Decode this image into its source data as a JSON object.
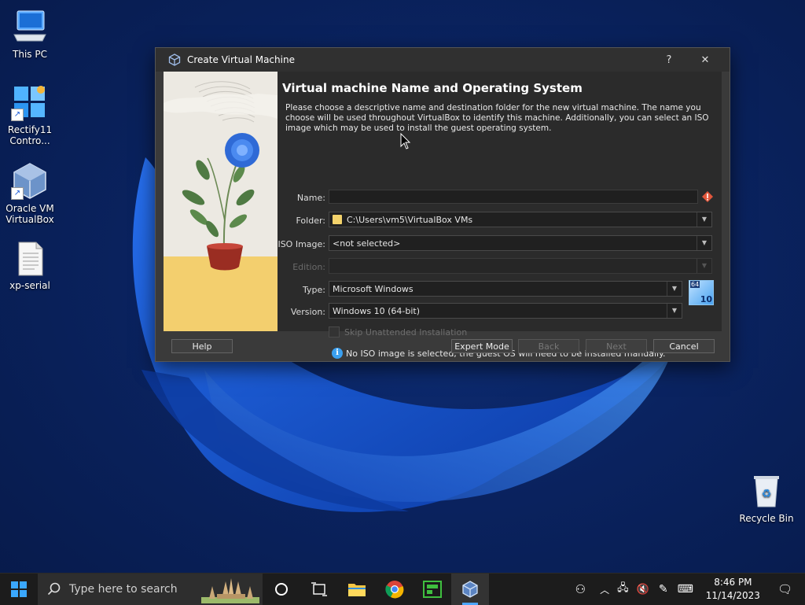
{
  "desktop": {
    "icons": [
      {
        "label": "This PC"
      },
      {
        "label": "Rectify11 Contro..."
      },
      {
        "label": "Oracle VM VirtualBox"
      },
      {
        "label": "xp-serial"
      },
      {
        "label": "Recycle Bin"
      }
    ]
  },
  "dialog": {
    "title": "Create Virtual Machine",
    "help_glyph": "?",
    "close_glyph": "✕",
    "heading": "Virtual machine Name and Operating System",
    "description": "Please choose a descriptive name and destination folder for the new virtual machine. The name you choose will be used throughout VirtualBox to identify this machine. Additionally, you can select an ISO image which may be used to install the guest operating system.",
    "fields": {
      "name_label": "Name:",
      "name_value": "",
      "folder_label": "Folder:",
      "folder_value": "C:\\Users\\vm5\\VirtualBox VMs",
      "iso_label": "ISO Image:",
      "iso_value": "<not selected>",
      "edition_label": "Edition:",
      "edition_value": "",
      "type_label": "Type:",
      "type_value": "Microsoft Windows",
      "version_label": "Version:",
      "version_value": "Windows 10 (64-bit)",
      "os_badge_top": "64",
      "os_badge_num": "10",
      "skip_label": "Skip Unattended Installation",
      "skip_checked": false,
      "info_text": "No ISO image is selected, the guest OS will need to be installed manually."
    },
    "buttons": {
      "help": "Help",
      "expert": "Expert Mode",
      "back": "Back",
      "next": "Next",
      "cancel": "Cancel"
    }
  },
  "taskbar": {
    "search_placeholder": "Type here to search",
    "time": "8:46 PM",
    "date": "11/14/2023"
  },
  "colors": {
    "accent": "#0078d4",
    "dialog_bg": "#2b2b2b",
    "warning": "#e2573c"
  }
}
